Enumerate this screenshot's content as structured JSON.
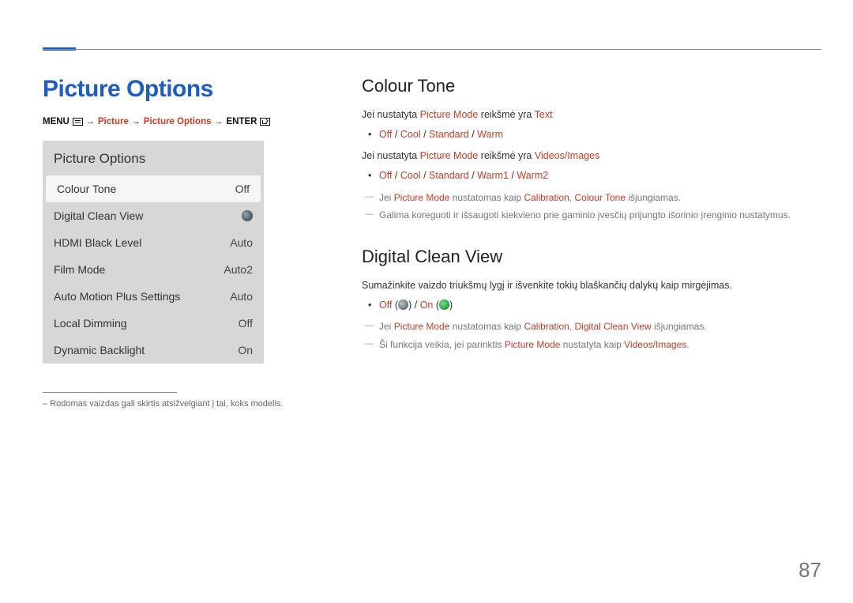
{
  "page_number": "87",
  "left": {
    "title": "Picture Options",
    "breadcrumb": {
      "menu": "MENU",
      "arrow": "→",
      "picture": "Picture",
      "picture_options": "Picture Options",
      "enter": "ENTER"
    },
    "panel": {
      "title": "Picture Options",
      "rows": [
        {
          "label": "Colour Tone",
          "value": "Off"
        },
        {
          "label": "Digital Clean View",
          "value": ""
        },
        {
          "label": "HDMI Black Level",
          "value": "Auto"
        },
        {
          "label": "Film Mode",
          "value": "Auto2"
        },
        {
          "label": "Auto Motion Plus Settings",
          "value": "Auto"
        },
        {
          "label": "Local Dimming",
          "value": "Off"
        },
        {
          "label": "Dynamic Backlight",
          "value": "On"
        }
      ]
    },
    "footnote": "– Rodomas vaizdas gali skirtis atsižvelgiant į tai, koks modelis."
  },
  "right": {
    "colour_tone": {
      "heading": "Colour Tone",
      "line1_a": "Jei nustatyta ",
      "line1_b": "Picture Mode",
      "line1_c": " reikšmė yra ",
      "line1_d": "Text",
      "bullet1_off": "Off",
      "bullet1_sep": " / ",
      "bullet1_cool": "Cool",
      "bullet1_standard": "Standard",
      "bullet1_warm": "Warm",
      "line2_a": "Jei nustatyta ",
      "line2_b": "Picture Mode",
      "line2_c": " reikšmė yra ",
      "line2_d": "Videos/Images",
      "bullet2_off": "Off",
      "bullet2_cool": "Cool",
      "bullet2_standard": "Standard",
      "bullet2_warm1": "Warm1",
      "bullet2_warm2": "Warm2",
      "note1_a": "Jei ",
      "note1_b": "Picture Mode",
      "note1_c": " nustatomas kaip ",
      "note1_d": "Calibration",
      "note1_e": ", ",
      "note1_f": "Colour Tone",
      "note1_g": " išjungiamas.",
      "note2": "Galima koreguoti ir išsaugoti kiekvieno prie gaminio įvesčių prijungto išorinio įrenginio nustatymus."
    },
    "dcv": {
      "heading": "Digital Clean View",
      "intro": "Sumažinkite vaizdo triukšmų lygį ir išvenkite tokių blaškančių dalykų kaip mirgėjimas.",
      "bullet_off": "Off",
      "bullet_open": " (",
      "bullet_close": ")",
      "bullet_sep": " / ",
      "bullet_on": "On",
      "note1_a": "Jei ",
      "note1_b": "Picture Mode",
      "note1_c": " nustatomas kaip ",
      "note1_d": "Calibration",
      "note1_e": ", ",
      "note1_f": "Digital Clean View",
      "note1_g": " išjungiamas.",
      "note2_a": "Ši funkcija veikia, jei parinktis ",
      "note2_b": "Picture Mode",
      "note2_c": " nustatyta kaip ",
      "note2_d": "Videos/Images",
      "note2_e": "."
    }
  }
}
